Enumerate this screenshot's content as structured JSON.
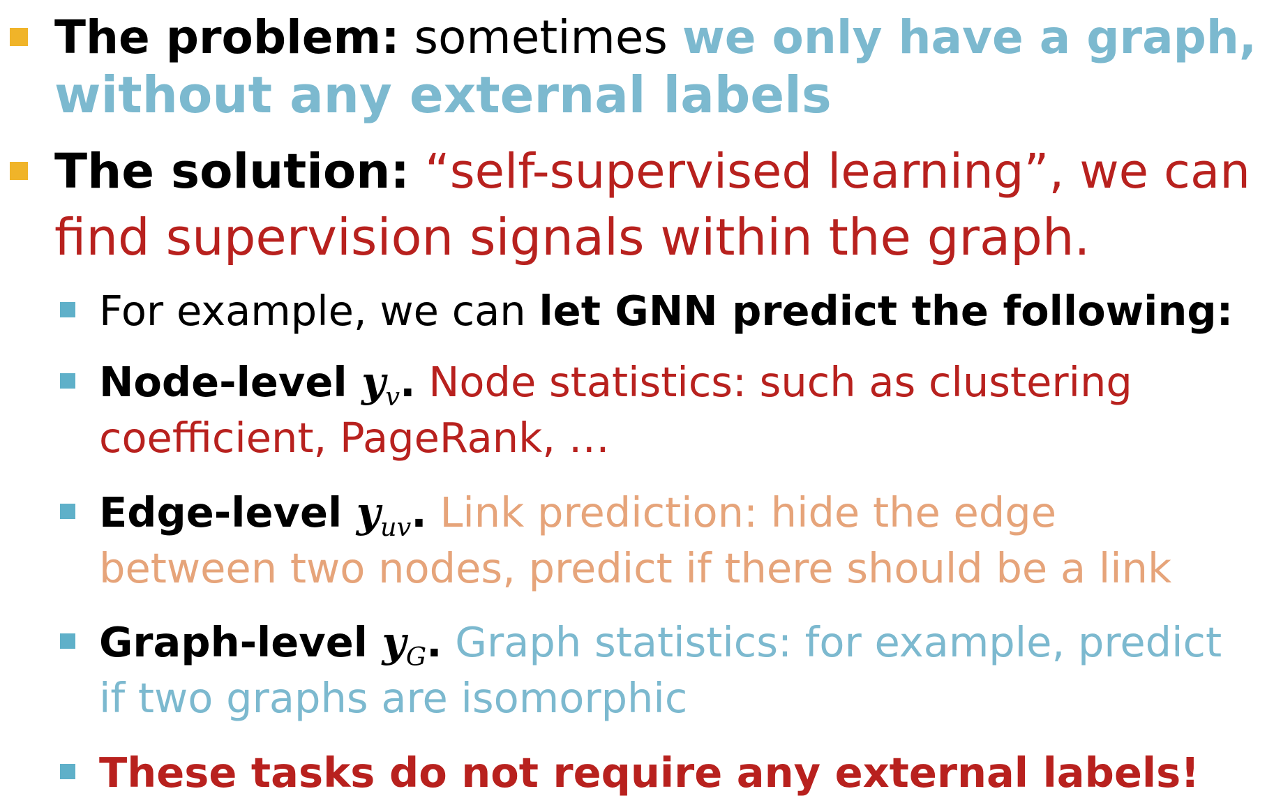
{
  "colors": {
    "bullet_level1": "#f0b429",
    "bullet_level2": "#5fb0c9",
    "blue_text": "#7cb9cf",
    "red_text": "#b8211e",
    "peach_text": "#e6a47a"
  },
  "problem": {
    "label": "The problem:",
    "text": " sometimes ",
    "highlight_line1": "we only have a graph,",
    "highlight_line2": "without any external labels"
  },
  "solution": {
    "label": "The solution:",
    "text_line1": " “self-supervised learning”, we can",
    "text_line2": "find supervision signals within the graph."
  },
  "example": {
    "prefix": "For example, we can ",
    "bold": "let GNN predict the following:"
  },
  "node_level": {
    "label": "Node-level ",
    "math_var": "y",
    "math_sub": "v",
    "period": ".",
    "desc_line1": " Node statistics: such as clustering",
    "desc_line2": "coefficient, PageRank, …"
  },
  "edge_level": {
    "label": "Edge-level ",
    "math_var": "y",
    "math_sub": "uv",
    "period": ".",
    "desc_line1": " Link prediction: hide the edge",
    "desc_line2": "between two nodes, predict if there should be a link"
  },
  "graph_level": {
    "label": "Graph-level ",
    "math_var": "y",
    "math_sub": "G",
    "period": ".",
    "desc_line1": " Graph statistics: for example, predict",
    "desc_line2": "if two graphs are isomorphic"
  },
  "conclusion": {
    "text": "These tasks do not require any external labels!"
  }
}
